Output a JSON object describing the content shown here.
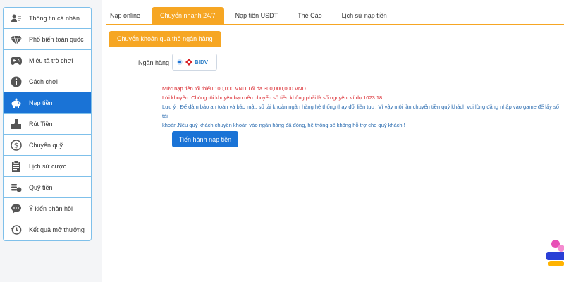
{
  "sidebar": {
    "items": [
      {
        "label": "Thông tin cá nhân",
        "icon": "id-card-icon"
      },
      {
        "label": "Phổ biến toàn quốc",
        "icon": "diamond-icon"
      },
      {
        "label": "Miêu tả trò chơi",
        "icon": "gamepad-icon"
      },
      {
        "label": "Cách chơi",
        "icon": "info-icon"
      },
      {
        "label": "Nạp tiền",
        "icon": "piggy-bank-icon"
      },
      {
        "label": "Rút Tiền",
        "icon": "withdraw-icon"
      },
      {
        "label": "Chuyển quỹ",
        "icon": "dollar-circle-icon"
      },
      {
        "label": "Lịch sử cược",
        "icon": "clipboard-icon"
      },
      {
        "label": "Quỹ tiền",
        "icon": "coins-icon"
      },
      {
        "label": "Ý kiến phản hồi",
        "icon": "chat-icon"
      },
      {
        "label": "Kết quả mở thưởng",
        "icon": "history-icon"
      }
    ],
    "active_index": 4
  },
  "tabs": [
    {
      "label": "Nạp online"
    },
    {
      "label": "Chuyển nhanh 24/7"
    },
    {
      "label": "Nạp tiền USDT"
    },
    {
      "label": "Thẻ Cào"
    },
    {
      "label": "Lịch sử nạp tiền"
    }
  ],
  "active_tab": 1,
  "subtab": {
    "label": "Chuyển khoản qua thẻ ngân hàng"
  },
  "bank": {
    "label": "Ngân hàng",
    "selected": "BIDV"
  },
  "notes": {
    "limit": "Mức nạp tiền tối thiểu 100,000 VND Tối đa 300,000,000 VND",
    "advice": "Lời khuyên: Chúng tôi khuyên bạn nên chuyển số tiền không phải là số nguyên, ví dụ 1023.18",
    "warning_1": "Lưu ý : Để đảm bảo an toàn và bảo mật, số tài khoản ngân hàng hệ thống thay đổi liên tục . Vì vậy mỗi lần chuyển tiền quý khách vui lòng đăng nhập vào game để lấy số tài",
    "warning_2": "khoản.Nếu quý khách chuyển khoản vào ngân hàng đã đóng, hệ thống sẽ không hỗ trợ cho quý khách !"
  },
  "submit_label": "Tiến hành nạp tiền",
  "colors": {
    "primary": "#1a73d6",
    "accent": "#f6a623",
    "warning": "#d9262c",
    "note": "#2b6cb0"
  }
}
